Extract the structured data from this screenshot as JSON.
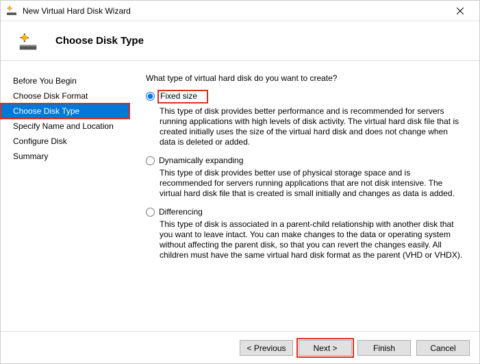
{
  "titlebar": {
    "title": "New Virtual Hard Disk Wizard"
  },
  "header": {
    "heading": "Choose Disk Type"
  },
  "sidebar": {
    "items": [
      {
        "label": "Before You Begin"
      },
      {
        "label": "Choose Disk Format"
      },
      {
        "label": "Choose Disk Type"
      },
      {
        "label": "Specify Name and Location"
      },
      {
        "label": "Configure Disk"
      },
      {
        "label": "Summary"
      }
    ],
    "selected_index": 2
  },
  "main": {
    "question": "What type of virtual hard disk do you want to create?",
    "options": [
      {
        "label": "Fixed size",
        "description": "This type of disk provides better performance and is recommended for servers running applications with high levels of disk activity. The virtual hard disk file that is created initially uses the size of the virtual hard disk and does not change when data is deleted or added."
      },
      {
        "label": "Dynamically expanding",
        "description": "This type of disk provides better use of physical storage space and is recommended for servers running applications that are not disk intensive. The virtual hard disk file that is created is small initially and changes as data is added."
      },
      {
        "label": "Differencing",
        "description": "This type of disk is associated in a parent-child relationship with another disk that you want to leave intact. You can make changes to the data or operating system without affecting the parent disk, so that you can revert the changes easily. All children must have the same virtual hard disk format as the parent (VHD or VHDX)."
      }
    ],
    "selected_option": 0
  },
  "footer": {
    "previous": "< Previous",
    "next": "Next >",
    "finish": "Finish",
    "cancel": "Cancel"
  }
}
